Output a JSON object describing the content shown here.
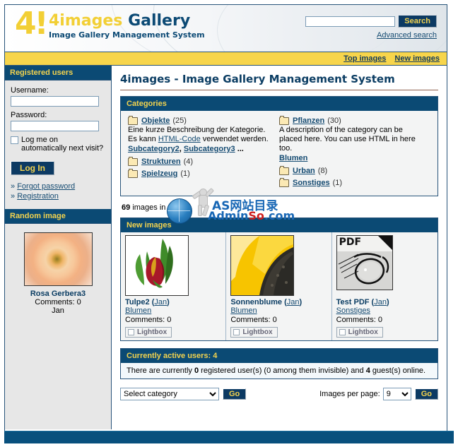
{
  "site": {
    "logo_mark": "4!",
    "logo_title_yellow": "4images",
    "logo_title_blue": "Gallery",
    "logo_subtitle": "Image Gallery Management System"
  },
  "search": {
    "value": "",
    "placeholder": "",
    "button_label": "Search",
    "advanced_link": "Advanced search"
  },
  "nav": {
    "items": [
      {
        "label": "Top images"
      },
      {
        "label": "New images"
      }
    ]
  },
  "sidebar": {
    "login_box": {
      "title": "Registered users",
      "username_label": "Username:",
      "username_value": "",
      "password_label": "Password:",
      "password_value": "",
      "remember_label": "Log me on automatically next visit?",
      "login_button": "Log In",
      "links": [
        {
          "chev": "»",
          "label": "Forgot password"
        },
        {
          "chev": "»",
          "label": "Registration"
        }
      ]
    },
    "random_box": {
      "title": "Random image",
      "image_name": "Rosa Gerbera3",
      "comments": "Comments: 0",
      "author": "Jan"
    }
  },
  "main": {
    "page_title": "4images - Image Gallery Management System",
    "categories_panel": {
      "title": "Categories",
      "columns": [
        [
          {
            "name": "Objekte",
            "count": "(25)",
            "desc_before": "Eine kurze Beschreibung der Kategorie. Es kann ",
            "desc_link": "HTML-Code",
            "desc_after": " verwendet werden.",
            "subs": [
              "Subcategory2",
              "Subcategory3"
            ],
            "subs_more": "..."
          },
          {
            "name": "Strukturen",
            "count": "(4)"
          },
          {
            "name": "Spielzeug",
            "count": "(1)"
          }
        ],
        [
          {
            "name": "Pflanzen",
            "count": "(30)",
            "desc_before": "A description of the category can be placed here. You can use HTML in here too.",
            "subs": [
              "Blumen"
            ]
          },
          {
            "name": "Urban",
            "count": "(8)"
          },
          {
            "name": "Sonstiges",
            "count": "(1)"
          }
        ]
      ]
    },
    "image_count": {
      "number": "69",
      "text": "images in 1"
    },
    "new_images_panel": {
      "title": "New images",
      "items": [
        {
          "title": "Tulpe2",
          "author": "Jan",
          "category": "Blumen",
          "comments": "Comments: 0",
          "lightbox": "Lightbox"
        },
        {
          "title": "Sonnenblume",
          "author": "Jan",
          "category": "Blumen",
          "comments": "Comments: 0",
          "lightbox": "Lightbox"
        },
        {
          "title": "Test PDF",
          "author": "Jan",
          "category": "Sonstiges",
          "comments": "Comments: 0",
          "lightbox": "Lightbox",
          "badge": "PDF"
        }
      ]
    },
    "active_users_panel": {
      "title": "Currently active users: 4",
      "text_1": "There are currently ",
      "registered_count": "0",
      "text_2": " registered user(s) (0 among them invisible) and ",
      "guest_count": "4",
      "text_3": " guest(s) online."
    },
    "controls": {
      "category_select_value": "Select category",
      "category_go": "Go",
      "images_per_page_label": "Images per page:",
      "images_per_page_value": "9",
      "images_per_page_go": "Go"
    }
  },
  "watermark": {
    "line1": "AS网站目录",
    "line2_admin": "Admin",
    "line2_so": "So",
    "line2_com": ".com"
  },
  "colors": {
    "header_blue": "#0b4a74",
    "accent_yellow": "#f7d54b",
    "link_blue": "#154B72",
    "title_blue": "#0b3d63"
  }
}
